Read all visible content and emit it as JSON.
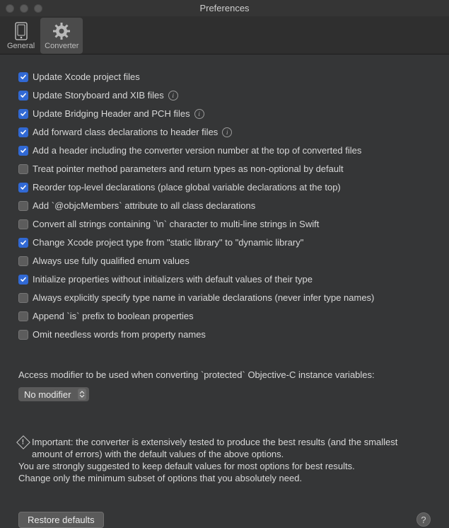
{
  "window": {
    "title": "Preferences"
  },
  "toolbar": {
    "general": "General",
    "converter": "Converter"
  },
  "options": [
    {
      "label": "Update Xcode project files",
      "checked": true,
      "info": false
    },
    {
      "label": "Update Storyboard and XIB files",
      "checked": true,
      "info": true
    },
    {
      "label": "Update Bridging Header and PCH files",
      "checked": true,
      "info": true
    },
    {
      "label": "Add forward class declarations to header files",
      "checked": true,
      "info": true
    },
    {
      "label": "Add a header including the converter version number at the top of converted files",
      "checked": true,
      "info": false
    },
    {
      "label": "Treat pointer method parameters and return types as non-optional by default",
      "checked": false,
      "info": false
    },
    {
      "label": "Reorder top-level declarations (place global variable declarations at the top)",
      "checked": true,
      "info": false
    },
    {
      "label": "Add `@objcMembers` attribute to all class declarations",
      "checked": false,
      "info": false
    },
    {
      "label": "Convert all strings containing `\\n` character to multi-line strings in Swift",
      "checked": false,
      "info": false
    },
    {
      "label": "Change Xcode project type from \"static library\" to \"dynamic library\"",
      "checked": true,
      "info": false
    },
    {
      "label": "Always use fully qualified enum values",
      "checked": false,
      "info": false
    },
    {
      "label": "Initialize properties without initializers with default values of their type",
      "checked": true,
      "info": false
    },
    {
      "label": "Always explicitly specify type name in variable declarations (never infer type names)",
      "checked": false,
      "info": false
    },
    {
      "label": "Append `is` prefix to boolean properties",
      "checked": false,
      "info": false
    },
    {
      "label": "Omit needless words from property names",
      "checked": false,
      "info": false
    }
  ],
  "accessModifier": {
    "label": "Access modifier to be used when converting `protected` Objective-C instance variables:",
    "selected": "No modifier"
  },
  "warning": {
    "line1": "Important: the converter is extensively tested to produce the best results (and the smallest amount of errors) with the default values of the above options.",
    "line2": "You are strongly suggested to keep default values for most options for best results.",
    "line3": "Change only the minimum subset of options that you absolutely need."
  },
  "footer": {
    "restore": "Restore defaults",
    "help": "?"
  }
}
